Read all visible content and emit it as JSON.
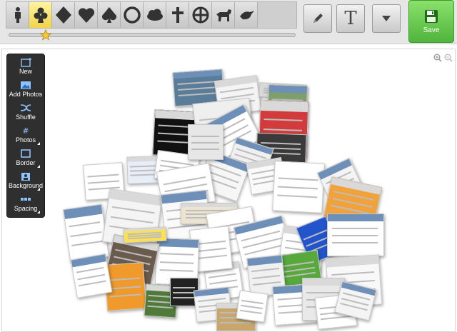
{
  "toolbar": {
    "shapes": [
      {
        "icon": "person-icon",
        "selected": false
      },
      {
        "icon": "club-icon",
        "selected": true
      },
      {
        "icon": "diamond-icon",
        "selected": false
      },
      {
        "icon": "heart-icon",
        "selected": false
      },
      {
        "icon": "spade-icon",
        "selected": false
      },
      {
        "icon": "circle-icon",
        "selected": false
      },
      {
        "icon": "cloud-icon",
        "selected": false
      },
      {
        "icon": "cross-icon",
        "selected": false
      },
      {
        "icon": "crosshair-circle-icon",
        "selected": false
      },
      {
        "icon": "dog-icon",
        "selected": false
      },
      {
        "icon": "bird-icon",
        "selected": false
      }
    ],
    "slider_value": 0.13,
    "text_tool_label": "T",
    "save_label": "Save"
  },
  "side_panel": {
    "items": [
      {
        "label": "New",
        "icon": "new-collage-icon",
        "has_menu": false
      },
      {
        "label": "Add Photos",
        "icon": "add-photos-icon",
        "has_menu": false
      },
      {
        "label": "Shuffle",
        "icon": "shuffle-icon",
        "has_menu": false
      },
      {
        "label": "Photos",
        "icon": "photos-count-icon",
        "has_menu": true
      },
      {
        "label": "Border",
        "icon": "border-icon",
        "has_menu": true
      },
      {
        "label": "Background",
        "icon": "background-icon",
        "has_menu": true
      },
      {
        "label": "Spacing",
        "icon": "spacing-icon",
        "has_menu": true
      }
    ]
  },
  "colors": {
    "shape_selected": "#f1d34a",
    "save_green": "#4fb53c",
    "panel_dark": "#2f2f2f"
  }
}
